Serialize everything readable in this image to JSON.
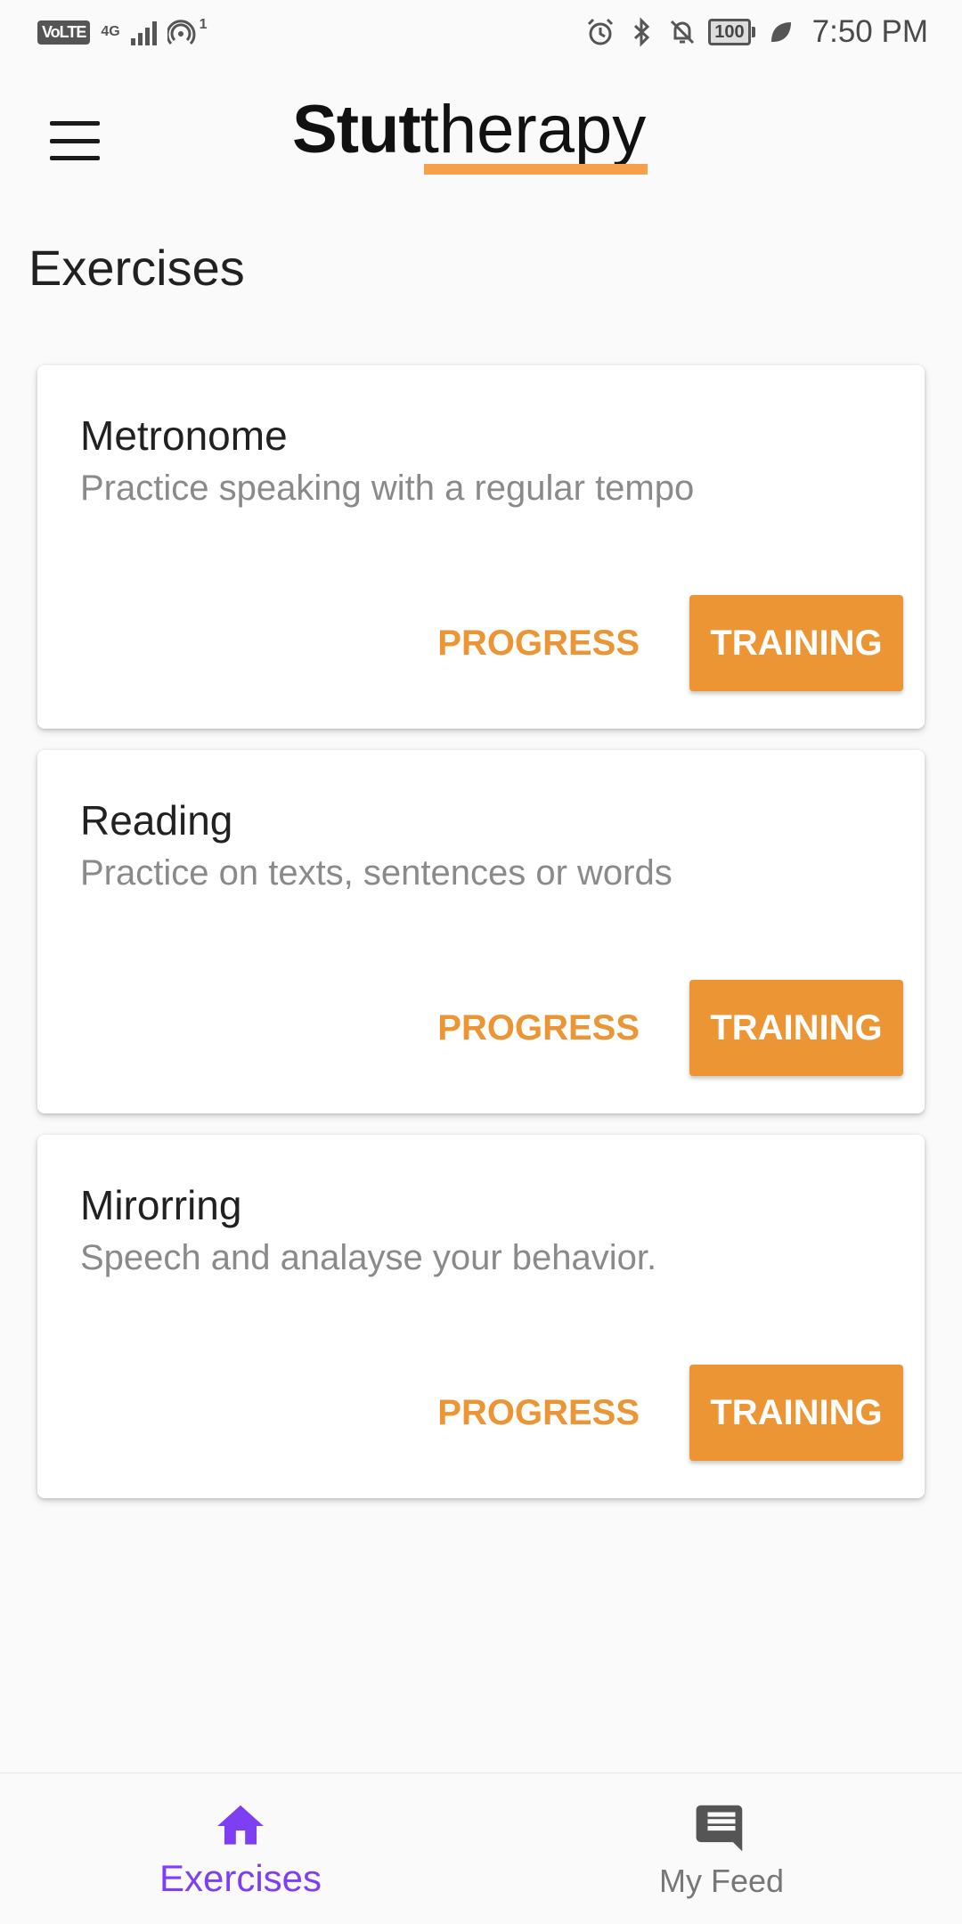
{
  "status_bar": {
    "volte": "VoLTE",
    "network": "4G",
    "hotspot_count": "1",
    "battery": "100",
    "time": "7:50 PM"
  },
  "app_bar": {
    "logo_part1": "Stut",
    "logo_part2": "therapy"
  },
  "page": {
    "title": "Exercises"
  },
  "exercises": [
    {
      "title": "Metronome",
      "description": "Practice speaking with a regular tempo",
      "progress_label": "PROGRESS",
      "training_label": "TRAINING"
    },
    {
      "title": "Reading",
      "description": "Practice on texts, sentences or words",
      "progress_label": "PROGRESS",
      "training_label": "TRAINING"
    },
    {
      "title": "Mirorring",
      "description": "Speech and analayse your behavior.",
      "progress_label": "PROGRESS",
      "training_label": "TRAINING"
    }
  ],
  "bottom_nav": {
    "items": [
      {
        "label": "Exercises",
        "icon": "home-icon",
        "active": true
      },
      {
        "label": "My Feed",
        "icon": "chat-icon",
        "active": false
      }
    ]
  },
  "colors": {
    "accent": "#EB9535",
    "nav_active": "#7E3FF2",
    "nav_inactive": "#555555",
    "logo_underline": "#F5A04A"
  }
}
